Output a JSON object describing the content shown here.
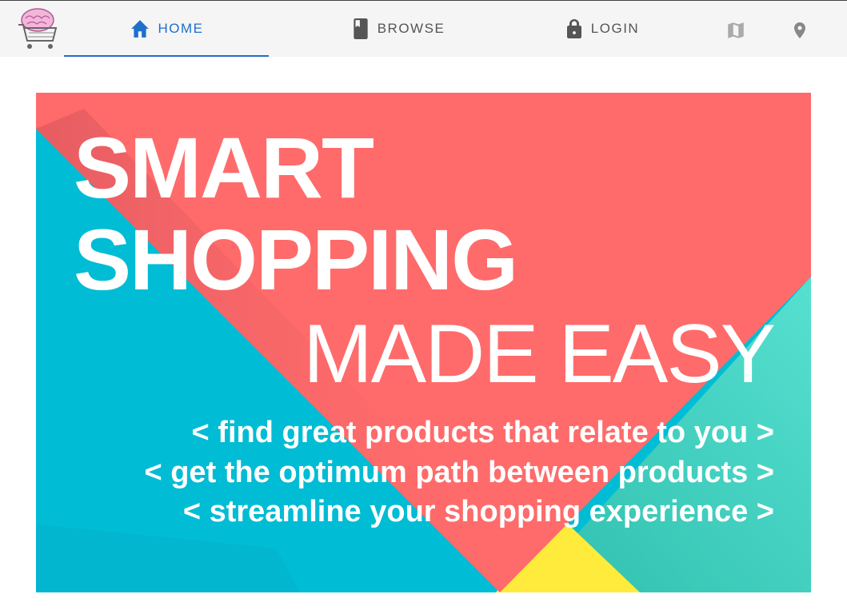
{
  "nav": {
    "tabs": [
      {
        "label": "HOME",
        "icon": "home-icon",
        "active": true
      },
      {
        "label": "BROWSE",
        "icon": "book-icon",
        "active": false
      },
      {
        "label": "LOGIN",
        "icon": "lock-icon",
        "active": false
      }
    ],
    "icons": [
      "map-icon",
      "location-pin-icon"
    ]
  },
  "hero": {
    "title_line1": "SMART",
    "title_line2": "SHOPPING",
    "subtitle": "MADE EASY",
    "lines": [
      "< find great products that relate to you >",
      "< get the optimum path between products >",
      "< streamline your shopping experience >"
    ]
  },
  "colors": {
    "accent": "#1f6fcc",
    "coral": "#ff6b6b",
    "cyan": "#00bcd4",
    "teal": "#56e0d0",
    "yellow": "#ffeb3b"
  }
}
